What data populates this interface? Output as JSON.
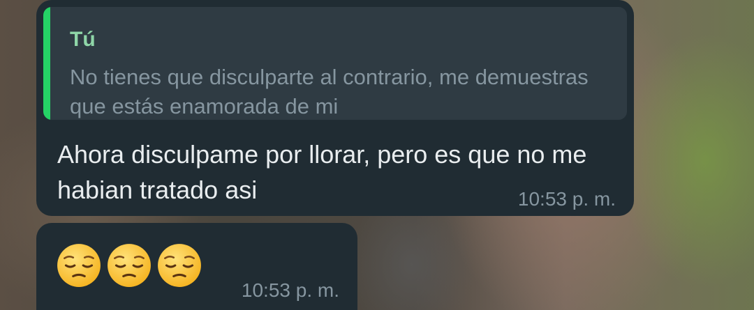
{
  "conversation": {
    "messages": [
      {
        "reply_to": {
          "author": "Tú",
          "text": "No tienes que disculparte al contrario, me demuestras que estás enamorada de mi"
        },
        "text": "Ahora disculpame por llorar, pero es que no me habian tratado asi",
        "time": "10:53 p. m."
      },
      {
        "emoji": [
          "pensive-face",
          "pensive-face",
          "pensive-face"
        ],
        "time": "10:53 p. m."
      }
    ]
  },
  "colors": {
    "bubble": "#202c33",
    "quote_background": "#2f3b43",
    "quote_bar": "#25d366",
    "quote_author": "#8fd6a8",
    "secondary_text": "#8696a0",
    "primary_text": "#e9edef"
  }
}
